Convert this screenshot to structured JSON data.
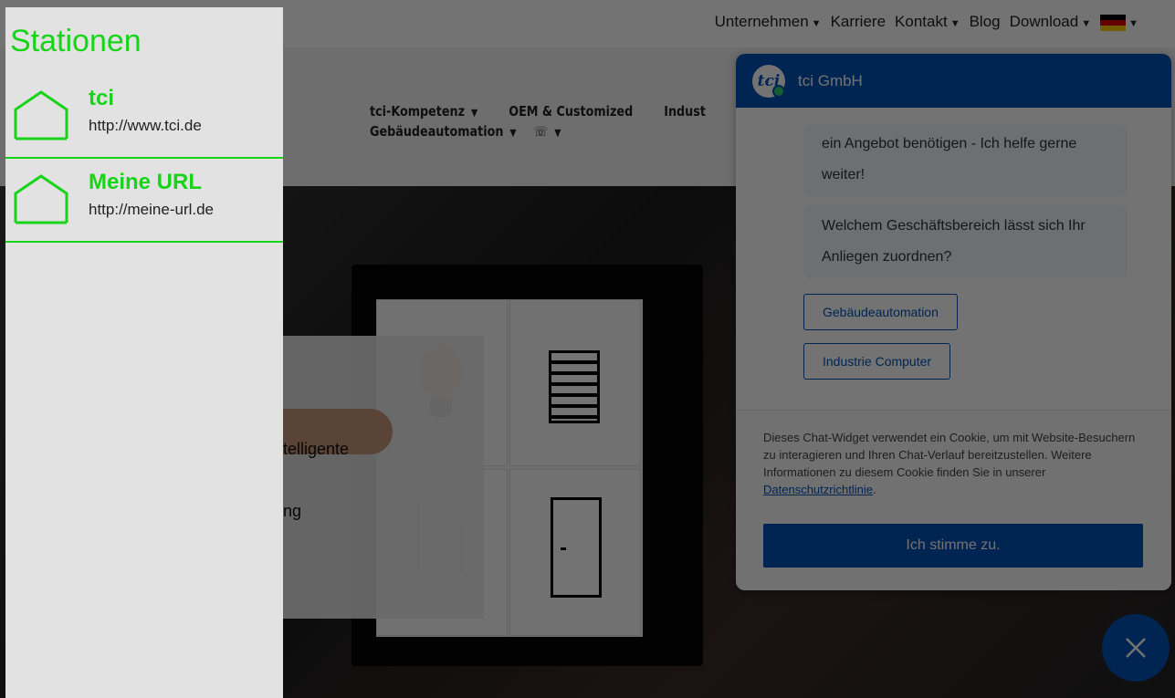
{
  "site": {
    "topnav": [
      "Unternehmen",
      "Karriere",
      "Kontakt",
      "Blog",
      "Download"
    ],
    "topnav_dropdowns": [
      true,
      false,
      true,
      false,
      true
    ],
    "mainnav_row1": [
      "tci-Kompetenz",
      "OEM & Customized",
      "Indust"
    ],
    "mainnav_row2": [
      "Gebäudeautomation",
      "☏"
    ],
    "hero_text": [
      "telligente",
      "ng"
    ]
  },
  "chat": {
    "title": "tci GmbH",
    "logo_text": "tci",
    "messages": [
      "ein Angebot benötigen - Ich helfe gerne weiter!",
      "Welchem Geschäftsbereich lässt sich Ihr Anliegen zuordnen?"
    ],
    "options": [
      "Gebäudeautomation",
      "Industrie Computer"
    ],
    "cookie_text": "Dieses Chat-Widget verwendet ein Cookie, um mit Website-Besuchern zu interagieren und Ihren Chat-Verlauf bereitzustellen. Weitere Informationen zu diesem Cookie finden Sie in unserer",
    "cookie_link": "Datenschutzrichtlinie",
    "cookie_end": ".",
    "agree_label": "Ich stimme zu.",
    "close_icon": "✕"
  },
  "drawer": {
    "title": "Stationen",
    "stations": [
      {
        "name": "tci",
        "url": "http://www.tci.de"
      },
      {
        "name": "Meine URL",
        "url": "http://meine-url.de"
      }
    ]
  },
  "colors": {
    "accent_green": "#18d418",
    "chat_blue": "#0353b6"
  }
}
